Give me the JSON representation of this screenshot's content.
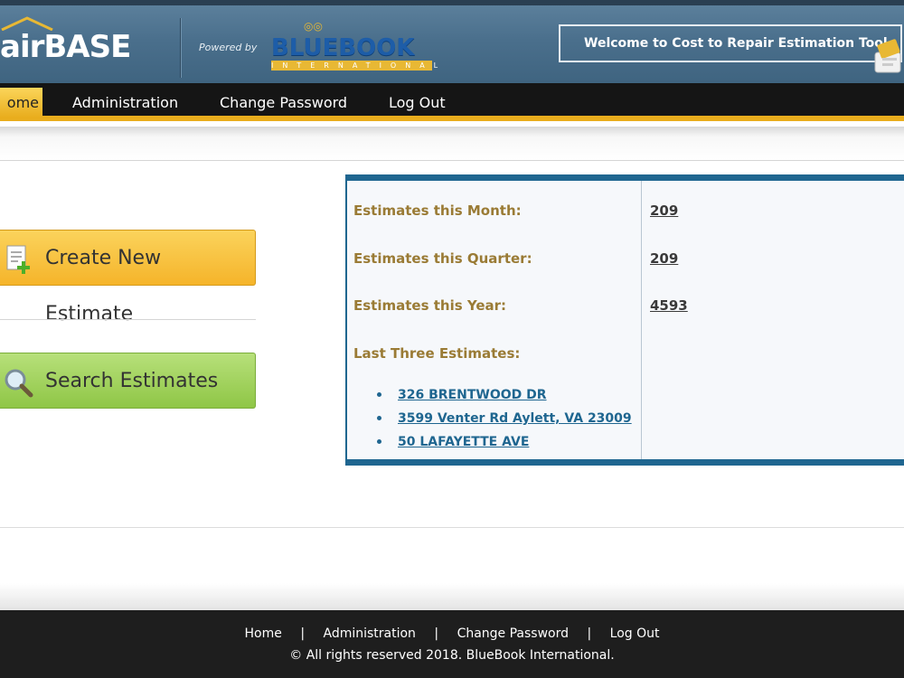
{
  "header": {
    "logo_text": "airBASE",
    "powered_by": "Powered by",
    "brand_name": "BLUEBOOK",
    "brand_sub": "INTERNATIONAL",
    "welcome": "Welcome to Cost to Repair Estimation Tool"
  },
  "nav": {
    "home": "ome",
    "administration": "Administration",
    "change_password": "Change Password",
    "log_out": "Log Out"
  },
  "actions": {
    "create_label": "Create New Estimate",
    "search_label": "Search Estimates"
  },
  "stats": {
    "month_label": "Estimates this Month:",
    "month_value": "209",
    "quarter_label": "Estimates this Quarter:",
    "quarter_value": "209",
    "year_label": "Estimates this Year:",
    "year_value": "4593",
    "recent_label": "Last Three Estimates:",
    "recent": [
      "326 BRENTWOOD DR",
      "3599 Venter Rd Aylett, VA 23009",
      "50 LAFAYETTE AVE"
    ]
  },
  "footer": {
    "home": "Home",
    "administration": "Administration",
    "change_password": "Change Password",
    "log_out": "Log Out",
    "separator": "|",
    "copyright": "© All rights reserved 2018. BlueBook International."
  },
  "colors": {
    "header_blue": "#4a6f8c",
    "accent_gold": "#e9ad1d",
    "panel_blue": "#1f6690",
    "label_gold": "#9a7b35",
    "create_orange": "#f5b42a",
    "search_green": "#8fc646"
  }
}
